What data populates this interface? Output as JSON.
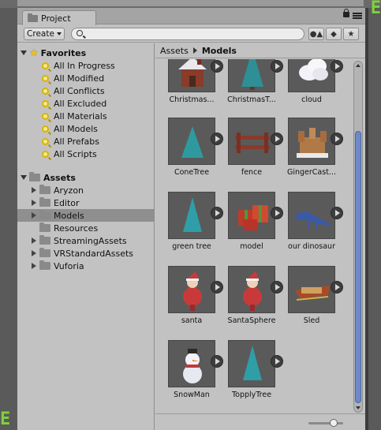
{
  "window": {
    "tab_label": "Project",
    "create_label": "Create",
    "search_placeholder": ""
  },
  "favorites": {
    "label": "Favorites",
    "items": [
      "All In Progress",
      "All Modified",
      "All Conflicts",
      "All Excluded",
      "All Materials",
      "All Models",
      "All Prefabs",
      "All Scripts"
    ]
  },
  "assets": {
    "label": "Assets",
    "folders": [
      "Aryzon",
      "Editor",
      "Models",
      "Resources",
      "StreamingAssets",
      "VRStandardAssets",
      "Vuforia"
    ],
    "selected": "Models"
  },
  "breadcrumb": [
    "Assets",
    "Models"
  ],
  "grid": {
    "items": [
      {
        "label": "Christmas...",
        "icon": "house-icon"
      },
      {
        "label": "ChristmasT...",
        "icon": "tree-icon"
      },
      {
        "label": "cloud",
        "icon": "cloud-icon"
      },
      {
        "label": "ConeTree",
        "icon": "cone-icon"
      },
      {
        "label": "fence",
        "icon": "fence-icon"
      },
      {
        "label": "GingerCast...",
        "icon": "castle-icon"
      },
      {
        "label": "green tree",
        "icon": "cone-icon"
      },
      {
        "label": "model",
        "icon": "gift-icon"
      },
      {
        "label": "our dinosaur",
        "icon": "dinosaur-icon"
      },
      {
        "label": "santa",
        "icon": "santa-icon"
      },
      {
        "label": "SantaSphere",
        "icon": "santa-icon"
      },
      {
        "label": "Sled",
        "icon": "sled-icon"
      },
      {
        "label": "SnowMan",
        "icon": "snowman-icon"
      },
      {
        "label": "TopplyTree",
        "icon": "cone-icon"
      }
    ]
  },
  "colors": {
    "accent_scroll": "#6f88c8",
    "selection": "#8f8f8f",
    "panel": "#c2c2c2"
  }
}
